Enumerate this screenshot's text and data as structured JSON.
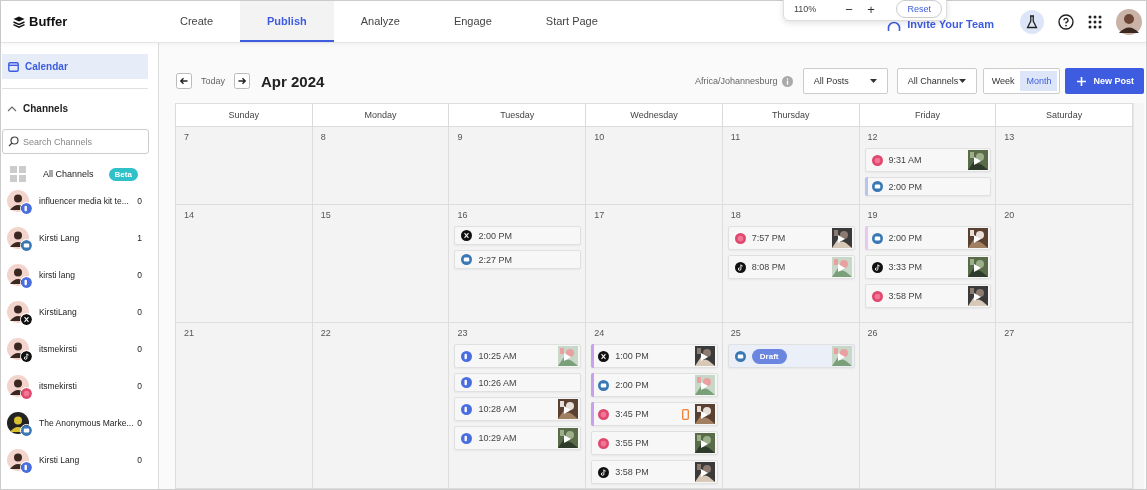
{
  "nav": {
    "logo": "Buffer",
    "tabs": [
      {
        "label": "Create",
        "selected": false
      },
      {
        "label": "Publish",
        "selected": true
      },
      {
        "label": "Analyze",
        "selected": false
      },
      {
        "label": "Engage",
        "selected": false
      },
      {
        "label": "Start Page",
        "selected": false
      }
    ],
    "invite": "Invite Your Team"
  },
  "zoom_popup": {
    "level": "110%",
    "minus": "−",
    "plus": "+",
    "reset": "Reset"
  },
  "sidebar": {
    "calendar": {
      "label": "Calendar",
      "selected": true
    },
    "channels_title": "Channels",
    "expanded": true,
    "search": {
      "placeholder": "Search Channels"
    },
    "all_channels": {
      "label": "All Channels",
      "badge": "Beta"
    },
    "channels": [
      {
        "name": "influencer media kit te...",
        "count": "0",
        "kind": "facebook"
      },
      {
        "name": "Kirsti Lang",
        "count": "1",
        "kind": "linkedin"
      },
      {
        "name": "kirsti lang",
        "count": "0",
        "kind": "facebook"
      },
      {
        "name": "KirstiLang",
        "count": "0",
        "kind": "x"
      },
      {
        "name": "itsmekirsti",
        "count": "0",
        "kind": "tiktok"
      },
      {
        "name": "itsmekirsti",
        "count": "0",
        "kind": "instagram"
      },
      {
        "name": "The Anonymous Marke...",
        "count": "0",
        "kind": "linkedin"
      },
      {
        "name": "Kirsti Lang",
        "count": "0",
        "kind": "facebook"
      }
    ]
  },
  "toolbar": {
    "today": "Today",
    "month": "Apr 2024",
    "timezone": "Africa/Johannesburg",
    "posts_filter": "All Posts",
    "channels_filter": "All Channels",
    "views": [
      {
        "label": "Week",
        "selected": false
      },
      {
        "label": "Month",
        "selected": true
      }
    ],
    "new_post": "New Post"
  },
  "calendar": {
    "weekdays": [
      "Sunday",
      "Monday",
      "Tuesday",
      "Wednesday",
      "Thursday",
      "Friday",
      "Saturday"
    ],
    "weeks": [
      {
        "days": [
          {
            "date": "7"
          },
          {
            "date": "8"
          },
          {
            "date": "9"
          },
          {
            "date": "10"
          },
          {
            "date": "11"
          },
          {
            "date": "12",
            "posts": [
              {
                "kind": "instagram",
                "time": "9:31 AM",
                "thumbnail": true
              },
              {
                "kind": "linkedin",
                "time": "2:00 PM",
                "thumbnail": false,
                "color": "#b8c4f0"
              }
            ]
          },
          {
            "date": "13"
          }
        ]
      },
      {
        "days": [
          {
            "date": "14"
          },
          {
            "date": "15"
          },
          {
            "date": "16",
            "posts": [
              {
                "kind": "x",
                "time": "2:00 PM",
                "thumbnail": false
              },
              {
                "kind": "linkedin",
                "time": "2:27 PM",
                "thumbnail": false
              }
            ]
          },
          {
            "date": "17"
          },
          {
            "date": "18",
            "posts": [
              {
                "kind": "instagram",
                "time": "7:57 PM",
                "thumbnail": true
              },
              {
                "kind": "tiktok",
                "time": "8:08 PM",
                "thumbnail": true
              }
            ]
          },
          {
            "date": "19",
            "posts": [
              {
                "kind": "linkedin",
                "time": "2:00 PM",
                "thumbnail": true,
                "color": "#e8c8f0"
              },
              {
                "kind": "tiktok",
                "time": "3:33 PM",
                "thumbnail": true
              },
              {
                "kind": "instagram",
                "time": "3:58 PM",
                "thumbnail": true
              }
            ]
          },
          {
            "date": "20"
          }
        ]
      },
      {
        "days": [
          {
            "date": "21"
          },
          {
            "date": "22"
          },
          {
            "date": "23",
            "posts": [
              {
                "kind": "facebook",
                "time": "10:25 AM",
                "thumbnail": true
              },
              {
                "kind": "facebook",
                "time": "10:26 AM",
                "thumbnail": false
              },
              {
                "kind": "facebook",
                "time": "10:28 AM",
                "thumbnail": true
              },
              {
                "kind": "facebook",
                "time": "10:29 AM",
                "thumbnail": true
              }
            ]
          },
          {
            "date": "24",
            "posts": [
              {
                "kind": "x",
                "time": "1:00 PM",
                "thumbnail": true,
                "color": "#c9a0f0"
              },
              {
                "kind": "linkedin",
                "time": "2:00 PM",
                "thumbnail": true,
                "color": "#c9a0f0"
              },
              {
                "kind": "instagram",
                "time": "3:45 PM",
                "thumbnail": true,
                "color": "#c9a0f0",
                "phone_reminder": true
              },
              {
                "kind": "instagram",
                "time": "3:55 PM",
                "thumbnail": true
              },
              {
                "kind": "tiktok",
                "time": "3:58 PM",
                "thumbnail": true
              }
            ]
          },
          {
            "date": "25",
            "posts": [
              {
                "kind": "linkedin",
                "draft": "Draft",
                "thumbnail": true
              }
            ]
          },
          {
            "date": "26"
          },
          {
            "date": "27"
          }
        ]
      }
    ]
  }
}
